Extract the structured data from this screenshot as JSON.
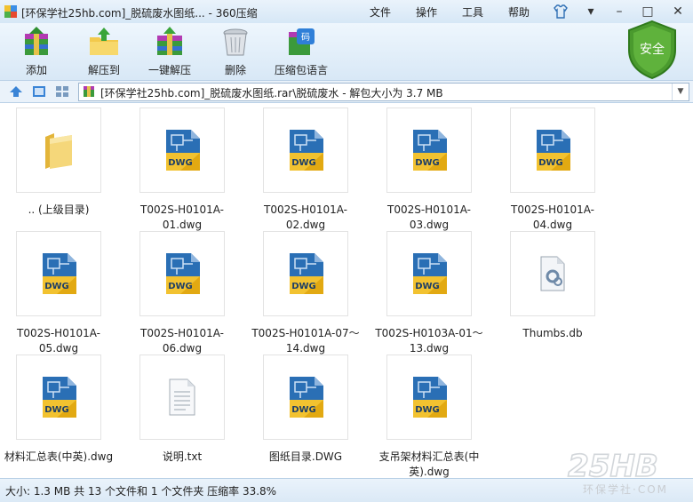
{
  "window": {
    "title": "[环保学社25hb.com]_脱硫废水图纸... - 360压缩"
  },
  "menu": [
    "文件",
    "操作",
    "工具",
    "帮助"
  ],
  "toolbar": [
    "添加",
    "解压到",
    "一键解压",
    "删除",
    "压缩包语言"
  ],
  "security_badge": "安全",
  "address": {
    "path": "[环保学社25hb.com]_脱硫废水图纸.rar\\脱硫废水 - 解包大小为 3.7 MB"
  },
  "files": [
    {
      "name": ".. (上级目录)",
      "icon": "folder"
    },
    {
      "name": "T002S-H0101A-01.dwg",
      "icon": "dwg"
    },
    {
      "name": "T002S-H0101A-02.dwg",
      "icon": "dwg"
    },
    {
      "name": "T002S-H0101A-03.dwg",
      "icon": "dwg"
    },
    {
      "name": "T002S-H0101A-04.dwg",
      "icon": "dwg"
    },
    {
      "name": "T002S-H0101A-05.dwg",
      "icon": "dwg"
    },
    {
      "name": "T002S-H0101A-06.dwg",
      "icon": "dwg"
    },
    {
      "name": "T002S-H0101A-07～14.dwg",
      "icon": "dwg"
    },
    {
      "name": "T002S-H0103A-01～13.dwg",
      "icon": "dwg"
    },
    {
      "name": "Thumbs.db",
      "icon": "db"
    },
    {
      "name": "材料汇总表(中英).dwg",
      "icon": "dwg"
    },
    {
      "name": "说明.txt",
      "icon": "txt"
    },
    {
      "name": "图纸目录.DWG",
      "icon": "dwg"
    },
    {
      "name": "支吊架材料汇总表(中英).dwg",
      "icon": "dwg"
    }
  ],
  "dwg_badge": "DWG",
  "status": "大小: 1.3 MB 共 13 个文件和 1 个文件夹 压缩率 33.8%",
  "watermark": {
    "logo": "25HB",
    "tagline": "环保学社·COM"
  }
}
